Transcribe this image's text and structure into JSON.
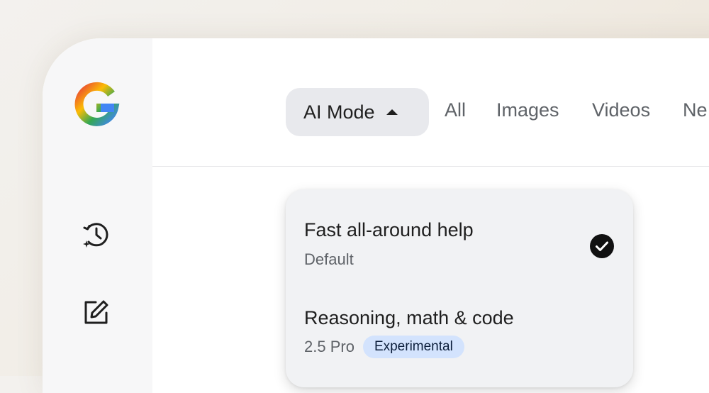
{
  "tabs": {
    "active": "AI Mode",
    "items": [
      "All",
      "Images",
      "Videos",
      "Ne"
    ]
  },
  "menu": {
    "options": [
      {
        "title": "Fast all-around help",
        "subtitle": "Default",
        "selected": true
      },
      {
        "title": "Reasoning, math & code",
        "subtitle": "2.5 Pro",
        "badge": "Experimental",
        "selected": false
      }
    ]
  },
  "sidebar": {
    "icons": [
      "google-logo-icon",
      "history-icon",
      "new-chat-icon"
    ]
  },
  "colors": {
    "tab_active_bg": "#e8e9ed",
    "menu_bg": "#f1f2f4",
    "badge_bg": "#d3e3fd",
    "text_primary": "#1f1f1f",
    "text_secondary": "#5f6368",
    "google_blue": "#4285F4",
    "google_red": "#EA4335",
    "google_yellow": "#FBBC05",
    "google_green": "#34A853"
  }
}
